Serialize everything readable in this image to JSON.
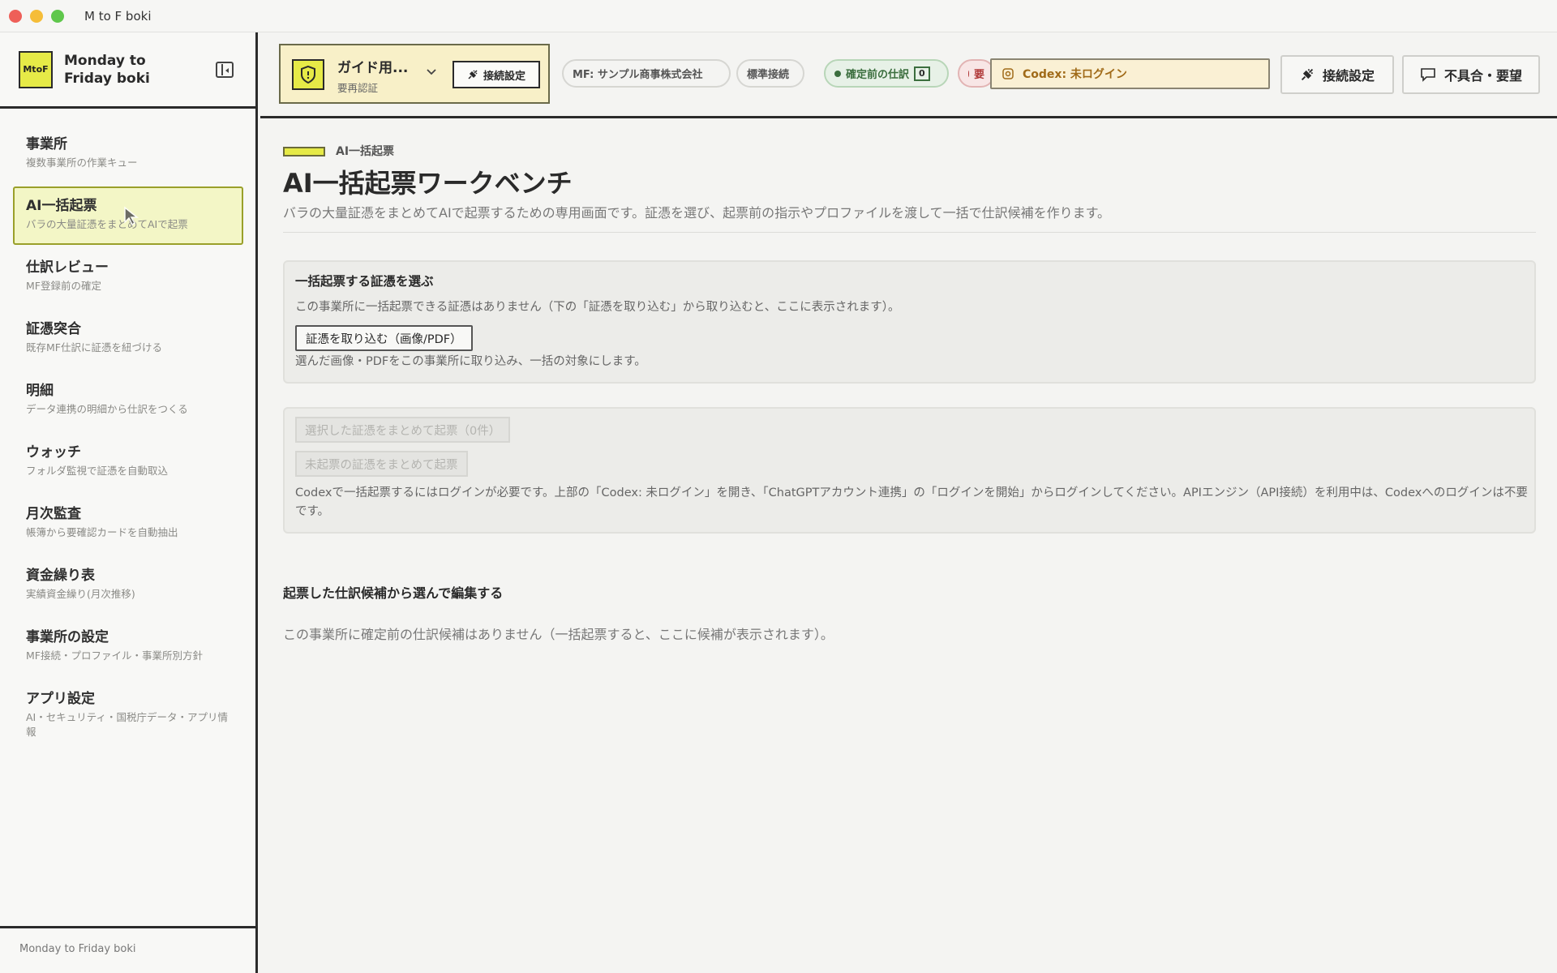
{
  "window": {
    "title": "M to F boki"
  },
  "brand": {
    "logo": "MtoF",
    "name": "Monday to Friday boki"
  },
  "sidebar": {
    "items": [
      {
        "label": "事業所",
        "sub": "複数事業所の作業キュー"
      },
      {
        "label": "AI一括起票",
        "sub": "バラの大量証憑をまとめてAIで起票"
      },
      {
        "label": "仕訳レビュー",
        "sub": "MF登録前の確定"
      },
      {
        "label": "証憑突合",
        "sub": "既存MF仕訳に証憑を紐づける"
      },
      {
        "label": "明細",
        "sub": "データ連携の明細から仕訳をつくる"
      },
      {
        "label": "ウォッチ",
        "sub": "フォルダ監視で証憑を自動取込"
      },
      {
        "label": "月次監査",
        "sub": "帳簿から要確認カードを自動抽出"
      },
      {
        "label": "資金繰り表",
        "sub": "実績資金繰り(月次推移)"
      },
      {
        "label": "事業所の設定",
        "sub": "MF接続・プロファイル・事業所別方針"
      },
      {
        "label": "アプリ設定",
        "sub": "AI・セキュリティ・国税庁データ・アプリ情報"
      }
    ],
    "footer": "Monday to Friday boki"
  },
  "toolbar": {
    "guide_title": "ガイド用...",
    "guide_sub": "要再認証",
    "connect_small": "接続設定",
    "company_pill": "MF: サンプル商事株式会社",
    "standard_pill": "標準接続",
    "confirm_pill": "確定前の仕訳",
    "confirm_count": "0",
    "required_pill": "要",
    "codex_status": "Codex: 未ログイン",
    "connect_button": "接続設定",
    "feedback_button": "不具合・要望"
  },
  "main": {
    "breadcrumb": "AI一括起票",
    "title": "AI一括起票ワークベンチ",
    "description": "バラの大量証憑をまとめてAIで起票するための専用画面です。証憑を選び、起票前の指示やプロファイルを渡して一括で仕訳候補を作ります。",
    "select_panel": {
      "title": "一括起票する証憑を選ぶ",
      "empty_text": "この事業所に一括起票できる証憑はありません（下の「証憑を取り込む」から取り込むと、ここに表示されます）。",
      "import_button": "証憑を取り込む（画像/PDF）",
      "import_hint": "選んだ画像・PDFをこの事業所に取り込み、一括の対象にします。"
    },
    "action_panel": {
      "selected_button": "選択した証憑をまとめて起票（0件）",
      "unposted_button": "未起票の証憑をまとめて起票",
      "note": "Codexで一括起票するにはログインが必要です。上部の「Codex: 未ログイン」を開き、「ChatGPTアカウント連携」の「ログインを開始」からログインしてください。APIエンジン（API接続）を利用中は、Codexへのログインは不要です。"
    },
    "candidates": {
      "title": "起票した仕訳候補から選んで編集する",
      "empty_text": "この事業所に確定前の仕訳候補はありません（一括起票すると、ここに候補が表示されます）。"
    }
  },
  "colors": {
    "accent": "#e6ea47",
    "active_bg": "#f3f6c6",
    "warning": "#a06a18",
    "success": "#3b6e3e",
    "danger": "#b03838"
  },
  "icons": {
    "shield": "shield-icon",
    "plug": "plug-icon",
    "chat": "chat-bubble-icon",
    "codex": "codex-icon",
    "collapse": "sidebar-collapse-icon"
  }
}
